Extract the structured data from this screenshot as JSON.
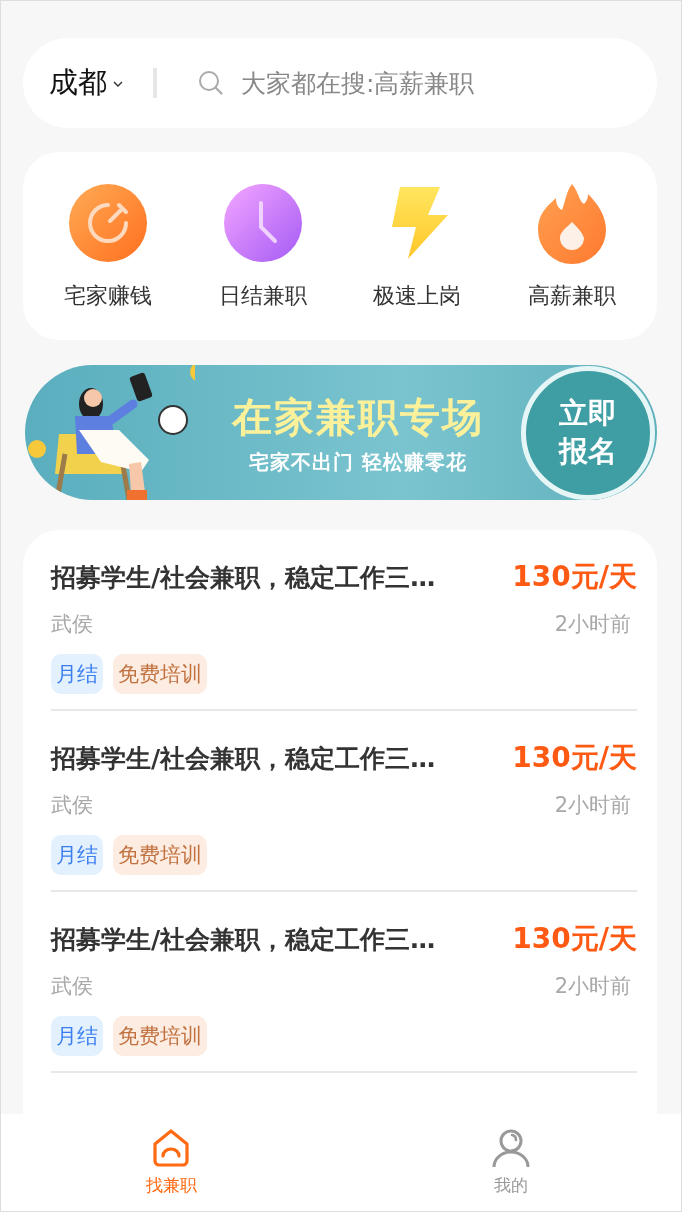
{
  "search_bar": {
    "city": "成都",
    "placeholder": "大家都在搜:高薪兼职"
  },
  "categories": [
    {
      "kind": "stopwatch",
      "label": "宅家赚钱"
    },
    {
      "kind": "clock",
      "label": "日结兼职"
    },
    {
      "kind": "bolt",
      "label": "极速上岗"
    },
    {
      "kind": "flame",
      "label": "高薪兼职"
    }
  ],
  "banner": {
    "title": "在家兼职专场",
    "subtitle": "宅家不出门 轻松赚零花",
    "button": "立即报名"
  },
  "jobs": [
    {
      "title": "招募学生/社会兼职，稳定工作三…",
      "salary": "130元/天",
      "location": "武侯",
      "time": "2小时前",
      "tags": [
        {
          "kind": "pay",
          "text": "月结"
        },
        {
          "kind": "benefit",
          "text": "免费培训"
        }
      ]
    },
    {
      "title": "招募学生/社会兼职，稳定工作三…",
      "salary": "130元/天",
      "location": "武侯",
      "time": "2小时前",
      "tags": [
        {
          "kind": "pay",
          "text": "月结"
        },
        {
          "kind": "benefit",
          "text": "免费培训"
        }
      ]
    },
    {
      "title": "招募学生/社会兼职，稳定工作三…",
      "salary": "130元/天",
      "location": "武侯",
      "time": "2小时前",
      "tags": [
        {
          "kind": "pay",
          "text": "月结"
        },
        {
          "kind": "benefit",
          "text": "免费培训"
        }
      ]
    }
  ],
  "tab_bar": [
    {
      "kind": "home",
      "label": "找兼职",
      "selected": true
    },
    {
      "kind": "person",
      "label": "我的",
      "selected": false
    }
  ]
}
